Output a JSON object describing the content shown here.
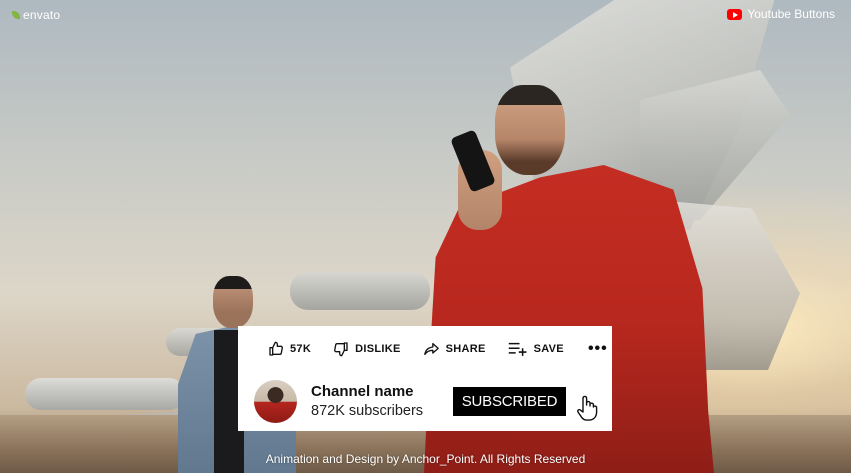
{
  "watermark": {
    "brand": "envato"
  },
  "title_tag": {
    "text": "Youtube Buttons",
    "icon": "youtube-logo-icon"
  },
  "actions": {
    "like": {
      "icon": "thumbs-up-icon",
      "label": "57K"
    },
    "dislike": {
      "icon": "thumbs-down-icon",
      "label": "DISLIKE"
    },
    "share": {
      "icon": "share-arrow-icon",
      "label": "SHARE"
    },
    "save": {
      "icon": "playlist-add-icon",
      "label": "SAVE"
    },
    "more": {
      "icon": "more-horizontal-icon",
      "label": "•••"
    }
  },
  "channel": {
    "name": "Channel name",
    "subscribers": "872K subscribers",
    "subscribe_label": "SUBSCRIBED"
  },
  "credit": "Animation and Design by Anchor_Point. All Rights Reserved",
  "colors": {
    "accent_red": "#ff0000",
    "subscribe_bg": "#000000",
    "card_bg": "#ffffff",
    "envato_green": "#82b541"
  }
}
